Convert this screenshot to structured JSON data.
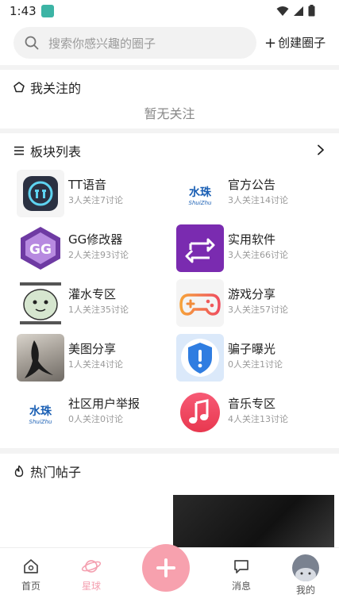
{
  "status_bar": {
    "time": "1:43"
  },
  "search": {
    "placeholder": "搜索你感兴趣的圈子",
    "create_label": "创建圈子"
  },
  "following": {
    "title": "我关注的",
    "empty_text": "暂无关注"
  },
  "boards": {
    "title": "板块列表",
    "items": [
      {
        "name": "TT语音",
        "stats": "3人关注7讨论",
        "icon": "tt-voice-icon",
        "color": "#2a3040"
      },
      {
        "name": "官方公告",
        "stats": "3人关注14讨论",
        "icon": "shuizhu-logo",
        "color": "#1a5fb4",
        "logo_text": "水珠",
        "logo_sub": "ShuiZhu"
      },
      {
        "name": "GG修改器",
        "stats": "2人关注93讨论",
        "icon": "gg-modifier-icon",
        "color": "#7b3fa8"
      },
      {
        "name": "实用软件",
        "stats": "3人关注66讨论",
        "icon": "swap-arrows-icon",
        "color": "#7a2bb0"
      },
      {
        "name": "灌水专区",
        "stats": "1人关注35讨论",
        "icon": "sticker-meme-icon",
        "color": "#cfe0c8"
      },
      {
        "name": "游戏分享",
        "stats": "3人关注57讨论",
        "icon": "gamepad-icon",
        "color": "#f28c3a"
      },
      {
        "name": "美图分享",
        "stats": "1人关注4讨论",
        "icon": "photo-thumbnail",
        "color": "#8a8a8a"
      },
      {
        "name": "骗子曝光",
        "stats": "0人关注1讨论",
        "icon": "shield-alert-icon",
        "color": "#2f7de1"
      },
      {
        "name": "社区用户举报",
        "stats": "0人关注0讨论",
        "icon": "shuizhu-logo",
        "color": "#1a5fb4",
        "logo_text": "水珠",
        "logo_sub": "ShuiZhu"
      },
      {
        "name": "音乐专区",
        "stats": "4人关注13讨论",
        "icon": "music-note-icon",
        "color": "#f0476b"
      }
    ]
  },
  "hot": {
    "title": "热门帖子"
  },
  "tabbar": {
    "items": [
      {
        "label": "首页",
        "icon": "home-icon"
      },
      {
        "label": "星球",
        "icon": "planet-icon",
        "active": true
      },
      {
        "label": "消息",
        "icon": "message-icon"
      },
      {
        "label": "我的",
        "icon": "avatar-icon"
      }
    ],
    "active_color": "#f4a0b0"
  }
}
